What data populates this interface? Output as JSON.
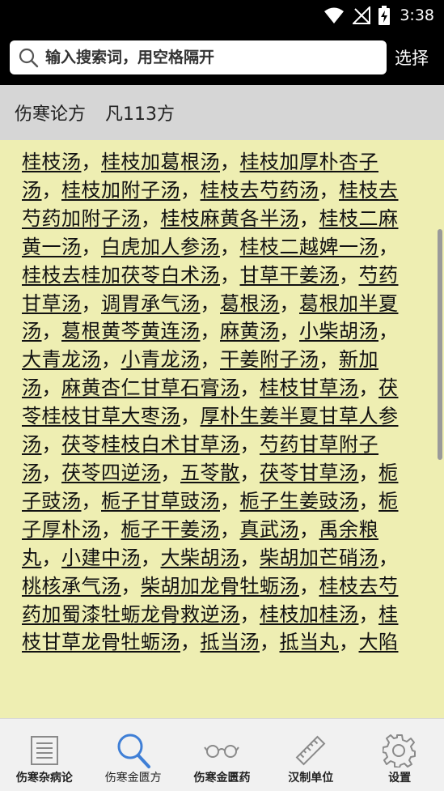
{
  "status_bar": {
    "time": "3:38"
  },
  "search": {
    "placeholder": "输入搜索词，用空格隔开",
    "select_label": "选择"
  },
  "section": {
    "title": "伤寒论方",
    "count": "凡113方"
  },
  "formulas": [
    "桂枝汤",
    "桂枝加葛根汤",
    "桂枝加厚朴杏子汤",
    "桂枝加附子汤",
    "桂枝去芍药汤",
    "桂枝去芍药加附子汤",
    "桂枝麻黄各半汤",
    "桂枝二麻黄一汤",
    "白虎加人参汤",
    "桂枝二越婢一汤",
    "桂枝去桂加茯苓白术汤",
    "甘草干姜汤",
    "芍药甘草汤",
    "调胃承气汤",
    "葛根汤",
    "葛根加半夏汤",
    "葛根黄芩黄连汤",
    "麻黄汤",
    "小柴胡汤",
    "大青龙汤",
    "小青龙汤",
    "干姜附子汤",
    "新加汤",
    "麻黄杏仁甘草石膏汤",
    "桂枝甘草汤",
    "茯苓桂枝甘草大枣汤",
    "厚朴生姜半夏甘草人参汤",
    "茯苓桂枝白术甘草汤",
    "芍药甘草附子汤",
    "茯苓四逆汤",
    "五苓散",
    "茯苓甘草汤",
    "栀子豉汤",
    "栀子甘草豉汤",
    "栀子生姜豉汤",
    "栀子厚朴汤",
    "栀子干姜汤",
    "真武汤",
    "禹余粮丸",
    "小建中汤",
    "大柴胡汤",
    "柴胡加芒硝汤",
    "桃核承气汤",
    "柴胡加龙骨牡蛎汤",
    "桂枝去芍药加蜀漆牡蛎龙骨救逆汤",
    "桂枝加桂汤",
    "桂枝甘草龙骨牡蛎汤",
    "抵当汤",
    "抵当丸",
    "大陷"
  ],
  "separator": "，",
  "nav": [
    {
      "label": "伤寒杂病论",
      "icon": "document-list-icon"
    },
    {
      "label": "伤寒金匮方",
      "icon": "search-icon"
    },
    {
      "label": "伤寒金匮药",
      "icon": "glasses-icon"
    },
    {
      "label": "汉制单位",
      "icon": "ruler-icon"
    },
    {
      "label": "设置",
      "icon": "gear-icon"
    }
  ],
  "colors": {
    "accent": "#3f7fd6",
    "content_bg": "#eeeeb2",
    "header_bg": "#d6d6d6"
  }
}
